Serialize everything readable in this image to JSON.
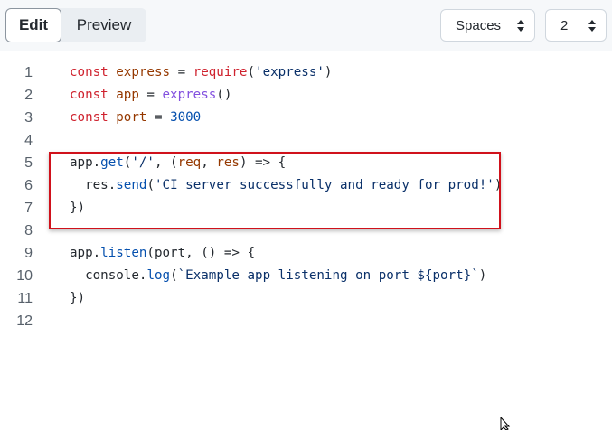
{
  "toolbar": {
    "edit_label": "Edit",
    "preview_label": "Preview",
    "indent_mode": "Spaces",
    "indent_size": "2"
  },
  "editor": {
    "lines": [
      {
        "num": "1"
      },
      {
        "num": "2"
      },
      {
        "num": "3"
      },
      {
        "num": "4"
      },
      {
        "num": "5"
      },
      {
        "num": "6"
      },
      {
        "num": "7"
      },
      {
        "num": "8"
      },
      {
        "num": "9"
      },
      {
        "num": "10"
      },
      {
        "num": "11"
      },
      {
        "num": "12"
      }
    ],
    "tokens": {
      "const": "const",
      "express": "express",
      "require": "require",
      "express_str": "'express'",
      "app": "app",
      "express_call": "express",
      "port": "port",
      "port_num": "3000",
      "get": "get",
      "slash_str": "'/'",
      "req": "req",
      "res": "res",
      "send": "send",
      "send_str": "'CI server successfully and ready for prod!'",
      "listen": "listen",
      "console": "console",
      "log": "log",
      "log_str": "`Example app listening on port ${port}`"
    }
  },
  "colors": {
    "highlight_border": "#d0111b",
    "keyword": "#cf222e",
    "string": "#0a3069"
  }
}
